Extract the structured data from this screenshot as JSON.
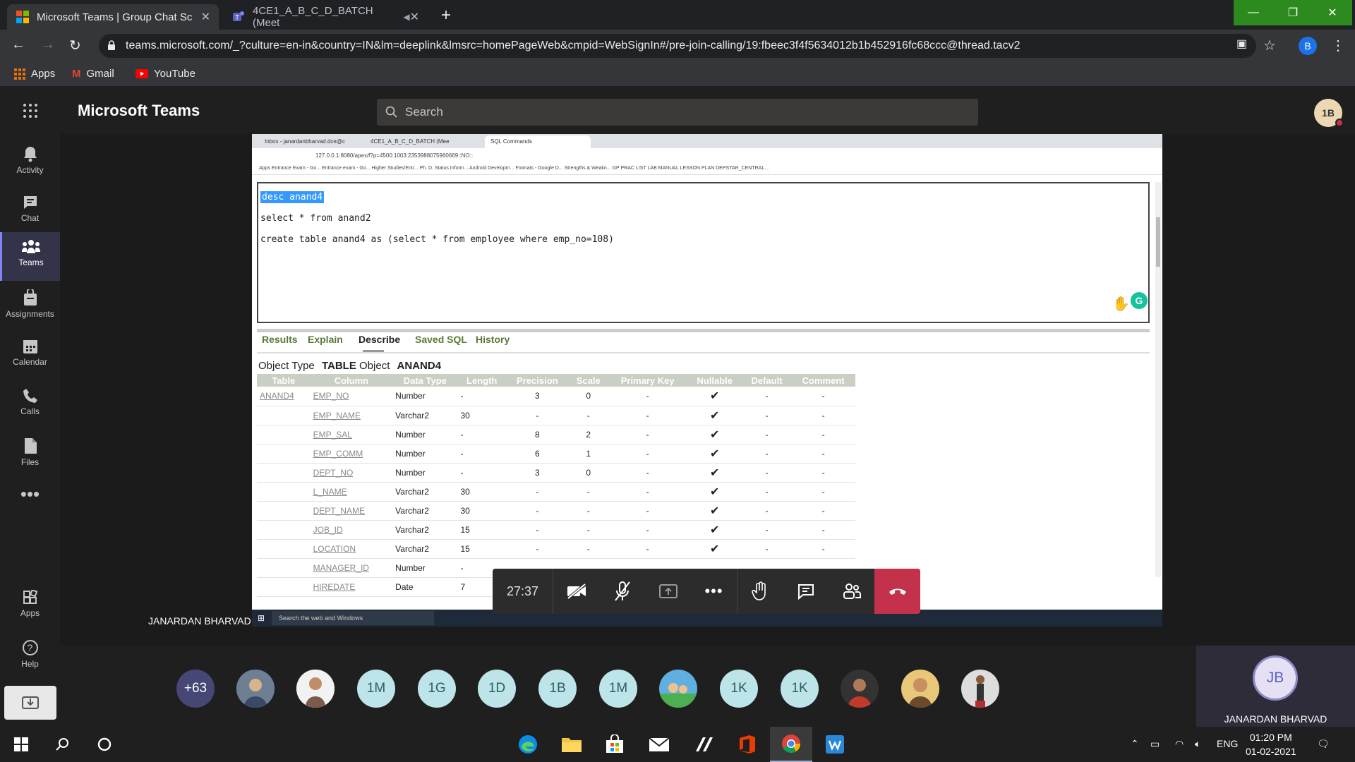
{
  "browser": {
    "tabs": [
      {
        "title": "Microsoft Teams | Group Chat Sc",
        "active": true
      },
      {
        "title": "4CE1_A_B_C_D_BATCH (Meet",
        "active": false
      }
    ],
    "url": "teams.microsoft.com/_?culture=en-in&country=IN&lm=deeplink&lmsrc=homePageWeb&cmpid=WebSignIn#/pre-join-calling/19:fbeec3f4f5634012b1b452916fc68ccc@thread.tacv2",
    "profile_initial": "B",
    "bookmarks": [
      "Apps",
      "Gmail",
      "YouTube"
    ]
  },
  "teams": {
    "app_title": "Microsoft Teams",
    "search_placeholder": "Search",
    "me_initials": "1B",
    "rail": [
      {
        "label": "Activity",
        "icon": "bell-icon"
      },
      {
        "label": "Chat",
        "icon": "chat-icon"
      },
      {
        "label": "Teams",
        "icon": "teams-icon",
        "active": true
      },
      {
        "label": "Assignments",
        "icon": "assignments-icon"
      },
      {
        "label": "Calendar",
        "icon": "calendar-icon"
      },
      {
        "label": "Calls",
        "icon": "phone-icon"
      },
      {
        "label": "Files",
        "icon": "files-icon"
      }
    ],
    "rail_bottom": [
      {
        "label": "Apps",
        "icon": "apps-icon"
      },
      {
        "label": "Help",
        "icon": "help-icon"
      }
    ],
    "presenter_name": "JANARDAN BHARVAD"
  },
  "shared": {
    "tabs": [
      "Inbox - janardanbharvad.dce@c",
      "4CE1_A_B_C_D_BATCH (Mee",
      "SQL Commands"
    ],
    "url": "127.0.0.1:8080/apex/f?p=4500:1003:2353988075960669::NO::",
    "bookmarks": "Apps   Entrance Exam - Go...   Entrance exam - Go...   Higher Studies/Entr...   Ph. D. Status Inform...   Android Developm...   Fromats - Google D...   Strengths & Weakn...   GP   PRAC LIST   LAB MANUAL   LESSON PLAN   DEPSTAR_CENTRAL...",
    "sql_lines": [
      "desc anand4",
      "select * from anand2",
      "create table anand4 as (select *  from employee where emp_no=108)"
    ],
    "result_tabs": [
      "Results",
      "Explain",
      "Describe",
      "Saved SQL",
      "History"
    ],
    "object_type_label": "Object Type",
    "object_type": "TABLE",
    "object_label": "Object",
    "object_name": "ANAND4",
    "columns": [
      "Table",
      "Column",
      "Data Type",
      "Length",
      "Precision",
      "Scale",
      "Primary Key",
      "Nullable",
      "Default",
      "Comment"
    ],
    "rows": [
      [
        "ANAND4",
        "EMP_NO",
        "Number",
        "-",
        "3",
        "0",
        "-",
        "✔",
        "-",
        "-"
      ],
      [
        "",
        "EMP_NAME",
        "Varchar2",
        "30",
        "-",
        "-",
        "-",
        "✔",
        "-",
        "-"
      ],
      [
        "",
        "EMP_SAL",
        "Number",
        "-",
        "8",
        "2",
        "-",
        "✔",
        "-",
        "-"
      ],
      [
        "",
        "EMP_COMM",
        "Number",
        "-",
        "6",
        "1",
        "-",
        "✔",
        "-",
        "-"
      ],
      [
        "",
        "DEPT_NO",
        "Number",
        "-",
        "3",
        "0",
        "-",
        "✔",
        "-",
        "-"
      ],
      [
        "",
        "L_NAME",
        "Varchar2",
        "30",
        "-",
        "-",
        "-",
        "✔",
        "-",
        "-"
      ],
      [
        "",
        "DEPT_NAME",
        "Varchar2",
        "30",
        "-",
        "-",
        "-",
        "✔",
        "-",
        "-"
      ],
      [
        "",
        "JOB_ID",
        "Varchar2",
        "15",
        "-",
        "-",
        "-",
        "✔",
        "-",
        "-"
      ],
      [
        "",
        "LOCATION",
        "Varchar2",
        "15",
        "-",
        "-",
        "-",
        "✔",
        "-",
        "-"
      ],
      [
        "",
        "MANAGER_ID",
        "Number",
        "-",
        "",
        "",
        "",
        "",
        "",
        ""
      ],
      [
        "",
        "HIREDATE",
        "Date",
        "7",
        "",
        "",
        "",
        "",
        "",
        ""
      ]
    ],
    "taskbar_search": "Search the web and Windows"
  },
  "call": {
    "timer": "27:37"
  },
  "participants": {
    "overflow": "+63",
    "initials": [
      "1M",
      "1G",
      "1D",
      "1B",
      "1M",
      "1K",
      "1K"
    ],
    "my_initials": "JB",
    "my_name": "JANARDAN BHARVAD"
  },
  "system": {
    "language": "ENG",
    "time": "01:20 PM",
    "date": "01-02-2021"
  }
}
